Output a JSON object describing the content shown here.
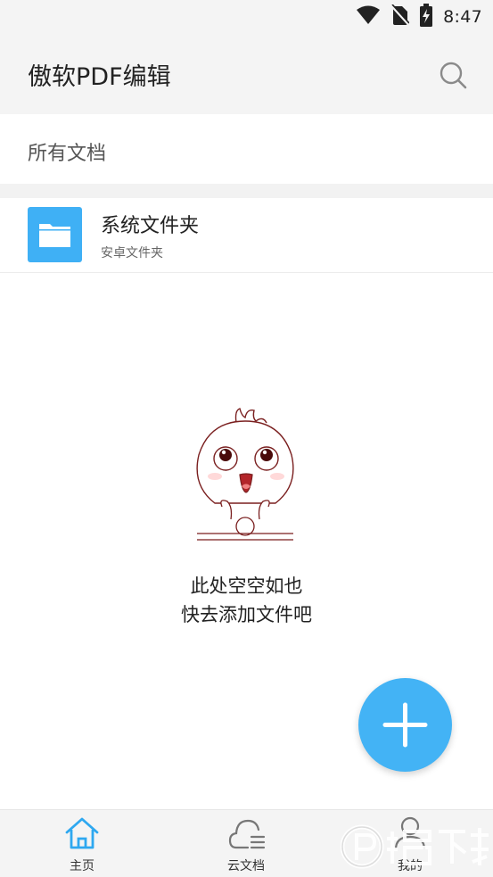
{
  "status_bar": {
    "time": "8:47",
    "icons": [
      "wifi-icon",
      "no-sim-icon",
      "battery-charging-icon"
    ]
  },
  "header": {
    "title": "傲软PDF编辑",
    "search_icon": "search-icon"
  },
  "section": {
    "label": "所有文档"
  },
  "folders": [
    {
      "name": "系统文件夹",
      "subtitle": "安卓文件夹",
      "icon": "folder-icon"
    }
  ],
  "empty_state": {
    "line1": "此处空空如也",
    "line2": "快去添加文件吧"
  },
  "fab": {
    "icon": "plus-icon"
  },
  "bottom_nav": [
    {
      "label": "主页",
      "icon": "home-icon",
      "active": true
    },
    {
      "label": "云文档",
      "icon": "cloud-doc-icon",
      "active": false
    },
    {
      "label": "我的",
      "icon": "user-icon",
      "active": false
    }
  ],
  "colors": {
    "accent": "#43b3f5",
    "header_bg": "#f4f4f4",
    "active_nav": "#2ea8f0"
  },
  "watermark": {
    "text": "精品下载"
  }
}
